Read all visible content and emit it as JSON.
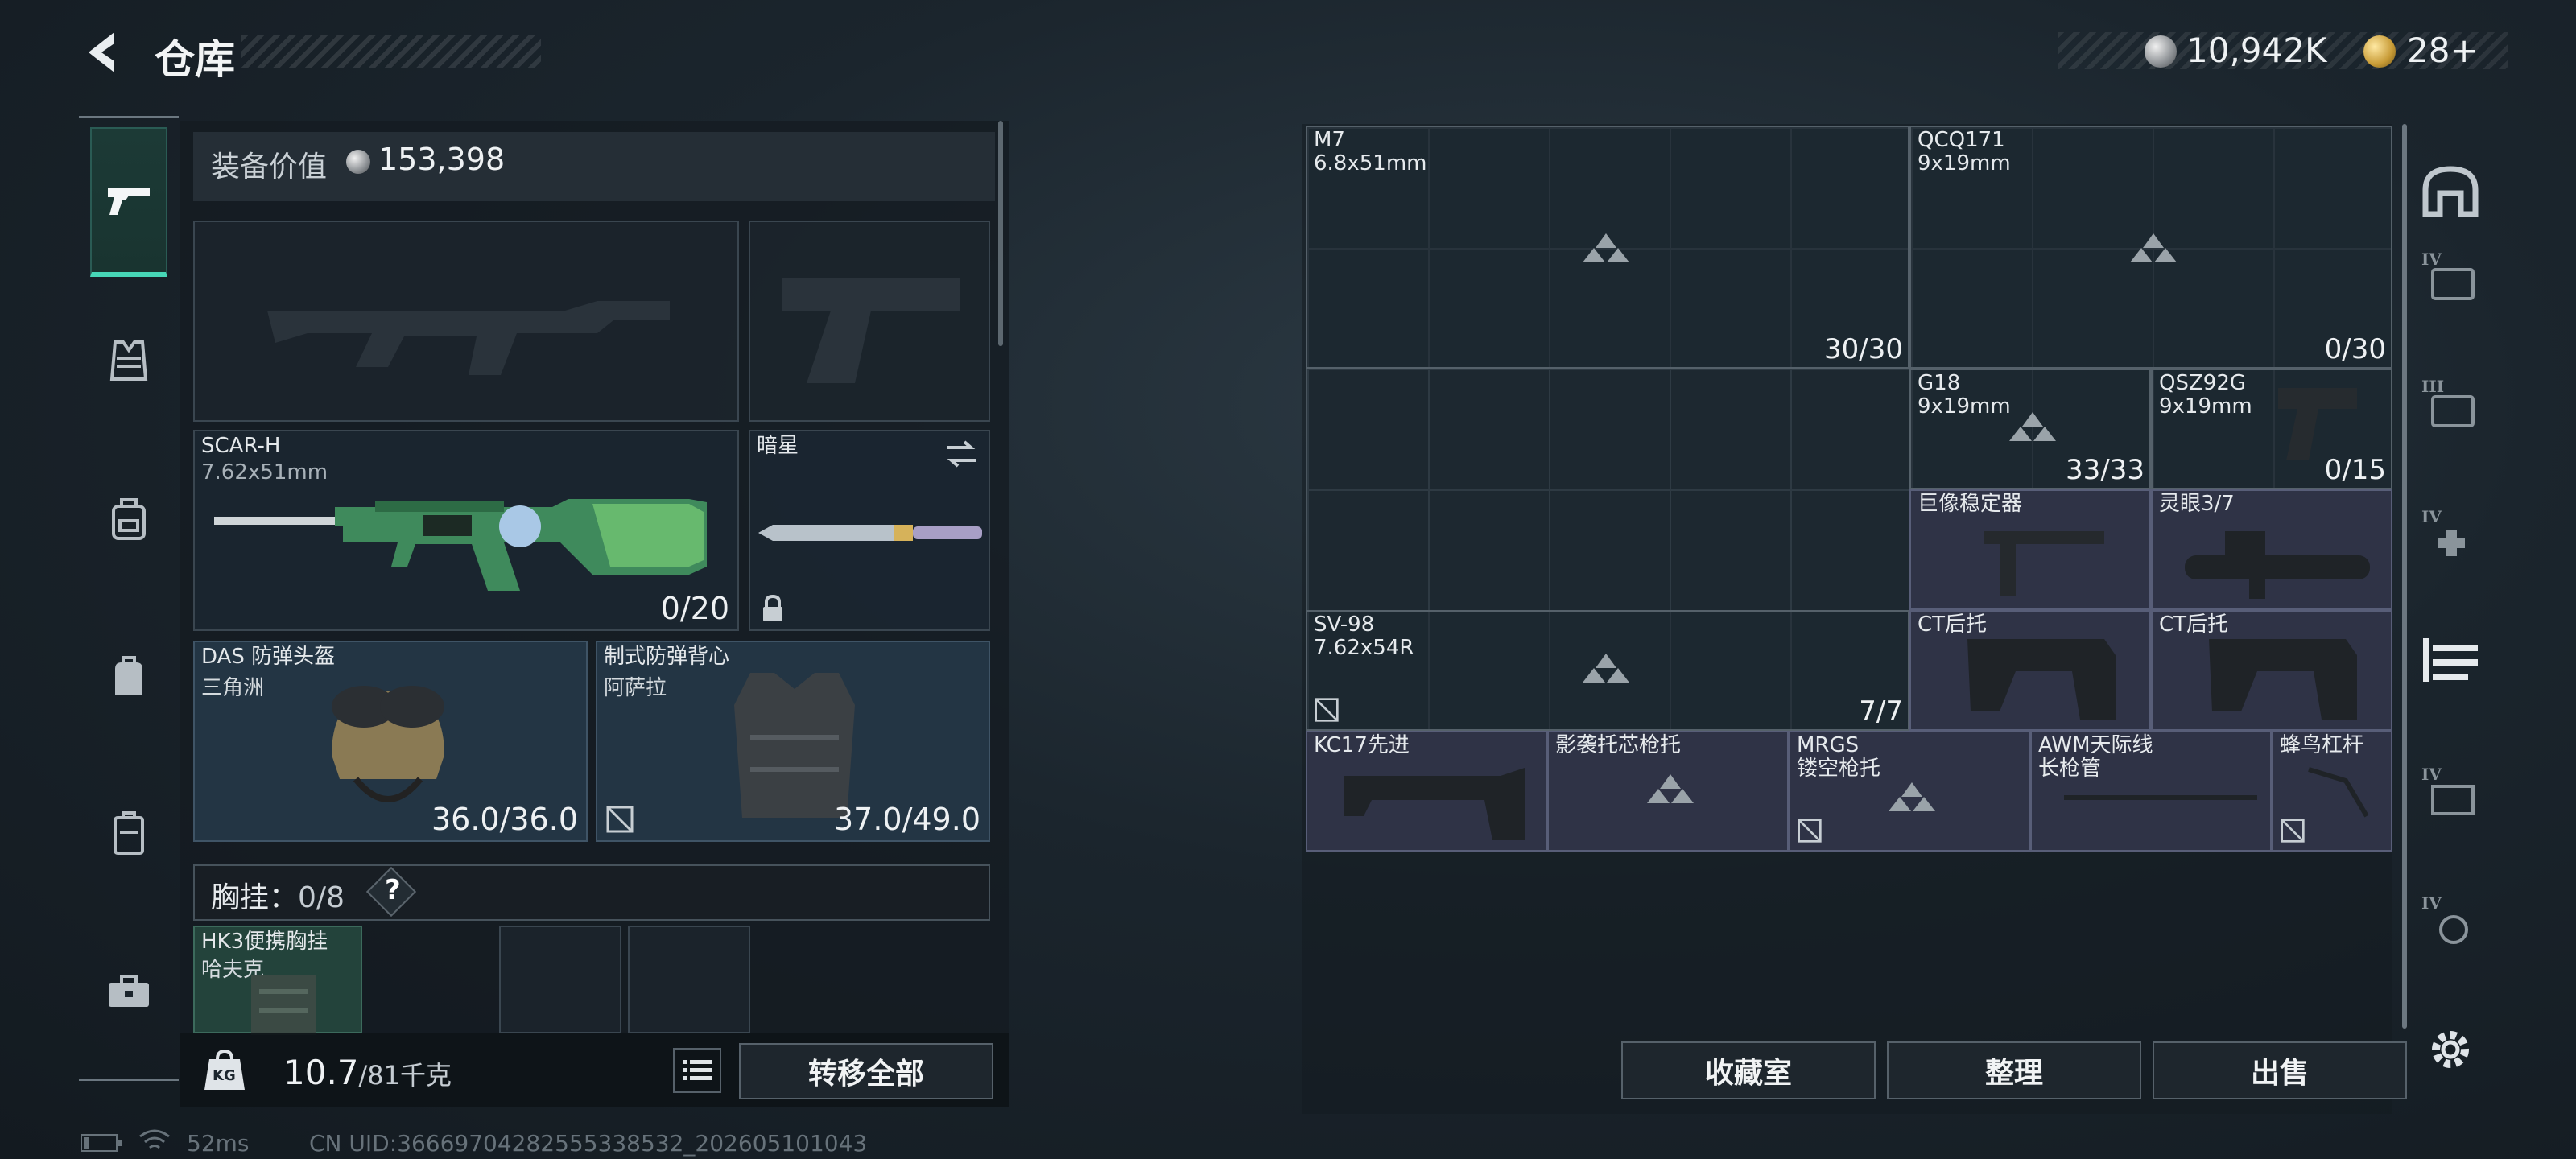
{
  "header": {
    "title": "仓库",
    "currency1": "10,942K",
    "currency2": "28+",
    "colors": {
      "accent": "#47d7b7",
      "purple_cell": "#2f3346"
    }
  },
  "left_nav": [
    "pistol-icon",
    "armor-icon",
    "backpack-icon",
    "bag-icon",
    "case-icon",
    "toolbox-icon"
  ],
  "loadout": {
    "equip_value_label": "装备价值",
    "equip_value": "153,398",
    "primary": {
      "name": "SCAR-H",
      "caliber": "7.62x51mm",
      "count": "0/20"
    },
    "melee": {
      "name": "暗星"
    },
    "helmet": {
      "name": "DAS 防弹头盔",
      "sub": "三角洲",
      "durability": "36.0/36.0"
    },
    "armor": {
      "name": "制式防弹背心",
      "sub": "阿萨拉",
      "durability": "37.0/49.0"
    },
    "chest_label": "胸挂",
    "chest_count": "0/8",
    "help": "?",
    "chest_item": {
      "name": "HK3便携胸挂",
      "sub": "哈夫克"
    },
    "weight": "10.7",
    "weight_total": "/81千克",
    "kg_label": "KG",
    "transfer_all": "转移全部"
  },
  "storage": {
    "items": [
      {
        "name": "M7",
        "sub": "6.8x51mm",
        "count": "30/30"
      },
      {
        "name": "QCQ171",
        "sub": "9x19mm",
        "count": "0/30"
      },
      {
        "name": "G18",
        "sub": "9x19mm",
        "count": "33/33"
      },
      {
        "name": "QSZ92G",
        "sub": "9x19mm",
        "count": "0/15"
      },
      {
        "name": "巨像稳定器",
        "sub": "",
        "count": ""
      },
      {
        "name": "灵眼3/7",
        "sub": "",
        "count": ""
      },
      {
        "name": "SV-98",
        "sub": "7.62x54R",
        "count": "7/7"
      },
      {
        "name": "CT后托",
        "sub": "",
        "count": ""
      },
      {
        "name": "CT后托",
        "sub": "",
        "count": ""
      },
      {
        "name": "KC17先进",
        "sub": "",
        "count": ""
      },
      {
        "name": "影袭托芯枪托",
        "sub": "",
        "count": ""
      },
      {
        "name": "MRGS",
        "sub": "镂空枪托",
        "count": ""
      },
      {
        "name": "AWM天际线",
        "sub": "长枪管",
        "count": ""
      },
      {
        "name": "蜂鸟杠杆",
        "sub": "",
        "count": ""
      }
    ],
    "buttons": {
      "collection": "收藏室",
      "sort": "整理",
      "sell": "出售"
    }
  },
  "right_nav": [
    "safehouse-icon",
    "tier4-case-icon",
    "tier3-case-icon",
    "tier4-medkit-icon",
    "weapon-rack-icon",
    "tier4-ammo-icon",
    "tier4-gear-icon",
    "settings-icon"
  ],
  "status": {
    "ping": "52ms",
    "uid": "CN UID:3666970428255533853­2_202605101043"
  }
}
